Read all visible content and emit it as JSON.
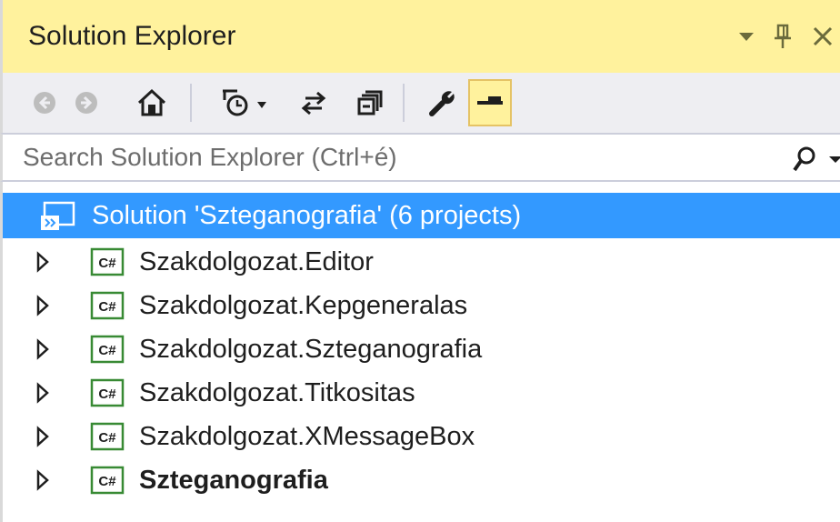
{
  "panel": {
    "title": "Solution Explorer"
  },
  "search": {
    "placeholder": "Search Solution Explorer (Ctrl+é)"
  },
  "tree": {
    "root": {
      "label": "Solution 'Szteganografia' (6 projects)"
    },
    "projects": [
      {
        "label": "Szakdolgozat.Editor",
        "bold": false
      },
      {
        "label": "Szakdolgozat.Kepgeneralas",
        "bold": false
      },
      {
        "label": "Szakdolgozat.Szteganografia",
        "bold": false
      },
      {
        "label": "Szakdolgozat.Titkositas",
        "bold": false
      },
      {
        "label": "Szakdolgozat.XMessageBox",
        "bold": false
      },
      {
        "label": "Szteganografia",
        "bold": true
      }
    ]
  },
  "colors": {
    "titlebar": "#fff29d",
    "toolbar": "#eeeef2",
    "selection": "#3399ff",
    "csharp_icon": "#388a34"
  }
}
